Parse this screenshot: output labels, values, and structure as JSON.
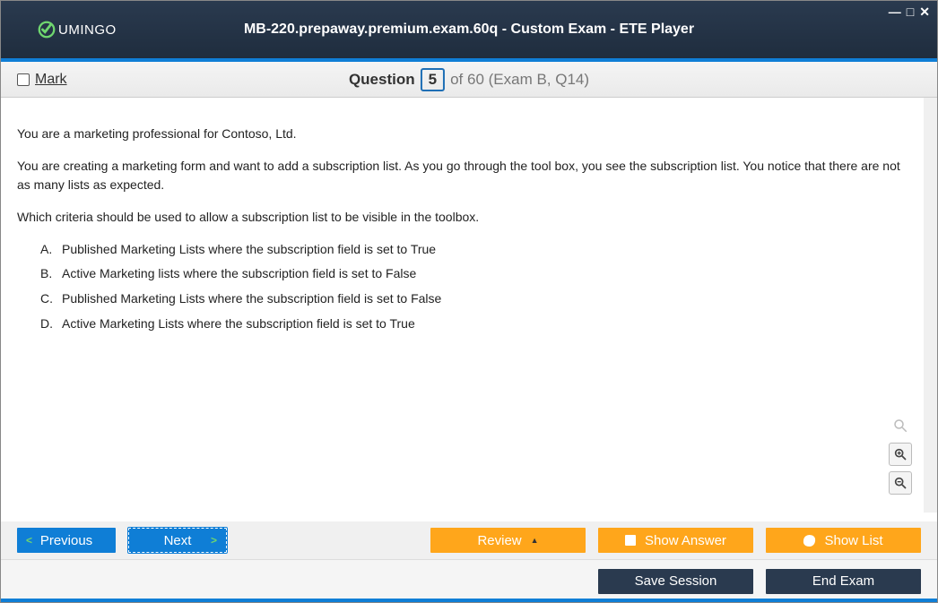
{
  "header": {
    "logo_text": "UMINGO",
    "title": "MB-220.prepaway.premium.exam.60q - Custom Exam - ETE Player"
  },
  "question_bar": {
    "mark_label": "Mark",
    "question_label": "Question",
    "current": "5",
    "total_text": "of 60 (Exam B, Q14)"
  },
  "question": {
    "p1": "You are a marketing professional for Contoso, Ltd.",
    "p2": "You are creating a marketing form and want to add a subscription list. As you go through the tool box, you see the subscription list. You notice that there are not as many lists as expected.",
    "p3": "Which criteria should be used to allow a subscription list to be visible in the toolbox.",
    "options": [
      {
        "letter": "A.",
        "text": "Published Marketing Lists where the subscription field is set to True"
      },
      {
        "letter": "B.",
        "text": "Active Marketing lists where the subscription field is set to False"
      },
      {
        "letter": "C.",
        "text": "Published Marketing Lists where the subscription field is set to False"
      },
      {
        "letter": "D.",
        "text": "Active Marketing Lists where the subscription field is set to True"
      }
    ]
  },
  "buttons": {
    "previous": "Previous",
    "next": "Next",
    "review": "Review",
    "show_answer": "Show Answer",
    "show_list": "Show List",
    "save_session": "Save Session",
    "end_exam": "End Exam"
  }
}
